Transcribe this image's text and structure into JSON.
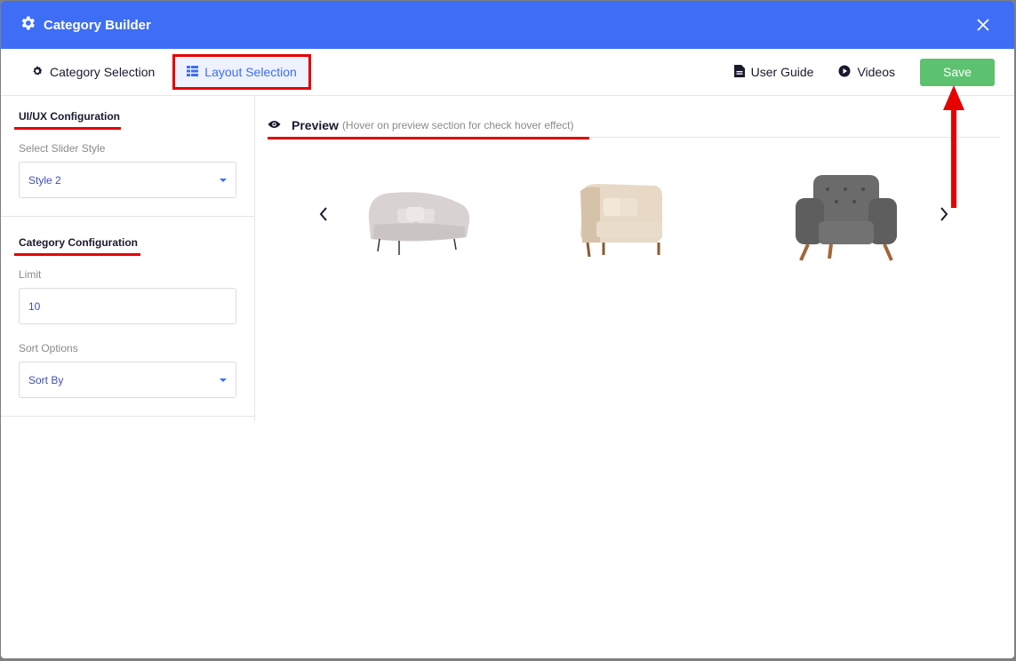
{
  "window": {
    "title": "Category Builder"
  },
  "nav": {
    "tab_category": "Category Selection",
    "tab_layout": "Layout Selection",
    "user_guide": "User Guide",
    "videos": "Videos",
    "save": "Save"
  },
  "sidebar": {
    "uiux_title": "UI/UX Configuration",
    "slider_style_label": "Select Slider Style",
    "slider_style_value": "Style 2",
    "category_title": "Category Configuration",
    "limit_label": "Limit",
    "limit_value": "10",
    "sort_label": "Sort Options",
    "sort_value": "Sort By"
  },
  "preview": {
    "title": "Preview",
    "hint": "(Hover on preview section for check hover effect)"
  },
  "colors": {
    "brand": "#3d6ef5",
    "save": "#5cc26f",
    "highlight": "#e60000"
  }
}
